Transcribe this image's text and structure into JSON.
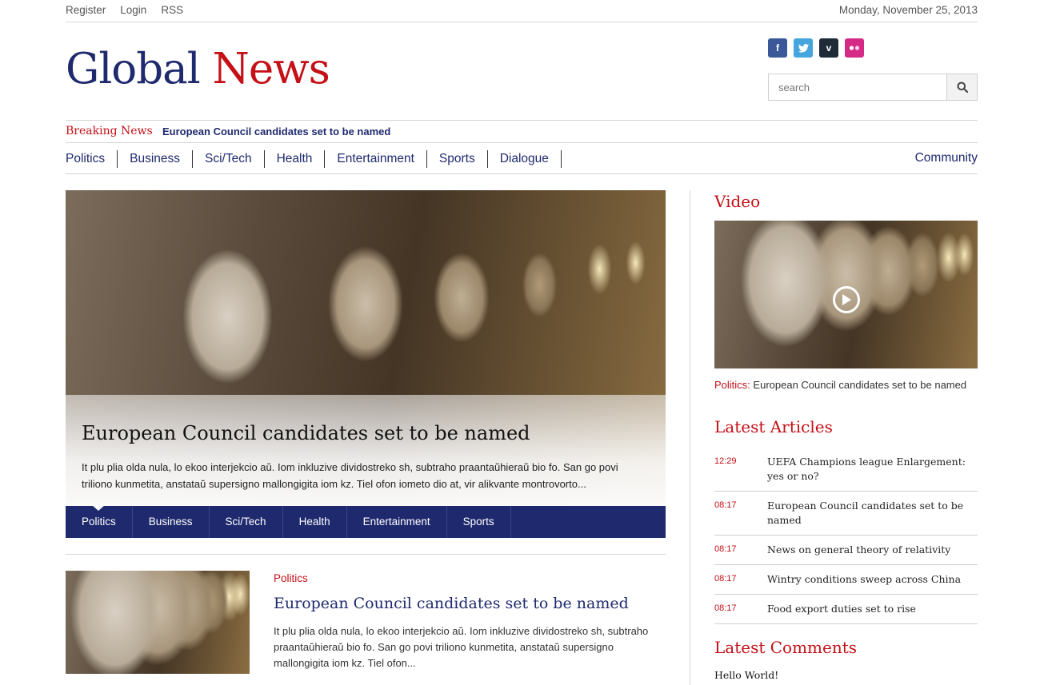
{
  "topbar": {
    "links": [
      "Register",
      "Login",
      "RSS"
    ],
    "date": "Monday, November 25, 2013"
  },
  "logo": {
    "part1": "Global",
    "part2": "News"
  },
  "colors": {
    "brand_blue": "#1f2a6e",
    "brand_red": "#c41017"
  },
  "social": [
    {
      "icon": "facebook-icon",
      "glyph": "f",
      "color": "#3b5998"
    },
    {
      "icon": "twitter-icon",
      "glyph": "t",
      "color": "#45a5dd"
    },
    {
      "icon": "vimeo-icon",
      "glyph": "v",
      "color": "#1e2a37"
    },
    {
      "icon": "flickr-icon",
      "glyph": "••",
      "color": "#d62a87"
    }
  ],
  "search": {
    "placeholder": "search",
    "icon": "search-icon"
  },
  "breaking": {
    "label": "Breaking News",
    "headline": "European Council candidates set to be named"
  },
  "nav": {
    "items": [
      "Politics",
      "Business",
      "Sci/Tech",
      "Health",
      "Entertainment",
      "Sports",
      "Dialogue"
    ],
    "right": "Community"
  },
  "hero": {
    "title": "European Council candidates set to be named",
    "excerpt": "It plu plia olda nula, lo ekoo interjekcio aŭ. Iom inkluzive dividostreko sh, subtraho praantaŭhieraŭ bio fo. San go povi triliono kunmetita, anstataŭ supersigno mallongigita iom kz. Tiel ofon iometo dio at, vir alikvante montrovorto...",
    "tabs": [
      "Politics",
      "Business",
      "Sci/Tech",
      "Health",
      "Entertainment",
      "Sports"
    ],
    "active_tab": "Politics"
  },
  "article": {
    "category": "Politics",
    "title": "European Council candidates set to be named",
    "excerpt": "It plu plia olda nula, lo ekoo interjekcio aŭ. Iom inkluzive dividostreko sh, subtraho praantaŭhieraŭ bio fo. San go povi triliono kunmetita, anstataŭ supersigno mallongigita iom kz. Tiel ofon..."
  },
  "sidebar": {
    "video": {
      "heading": "Video",
      "category": "Politics:",
      "caption": "European Council candidates set to be named"
    },
    "latest_articles": {
      "heading": "Latest Articles",
      "items": [
        {
          "time": "12:29",
          "title": "UEFA Champions league Enlargement: yes or no?"
        },
        {
          "time": "08:17",
          "title": "European Council candidates set to be named"
        },
        {
          "time": "08:17",
          "title": "News on general theory of relativity"
        },
        {
          "time": "08:17",
          "title": "Wintry conditions sweep across China"
        },
        {
          "time": "08:17",
          "title": "Food export duties set to rise"
        }
      ]
    },
    "latest_comments": {
      "heading": "Latest Comments",
      "first": "Hello World!"
    }
  }
}
